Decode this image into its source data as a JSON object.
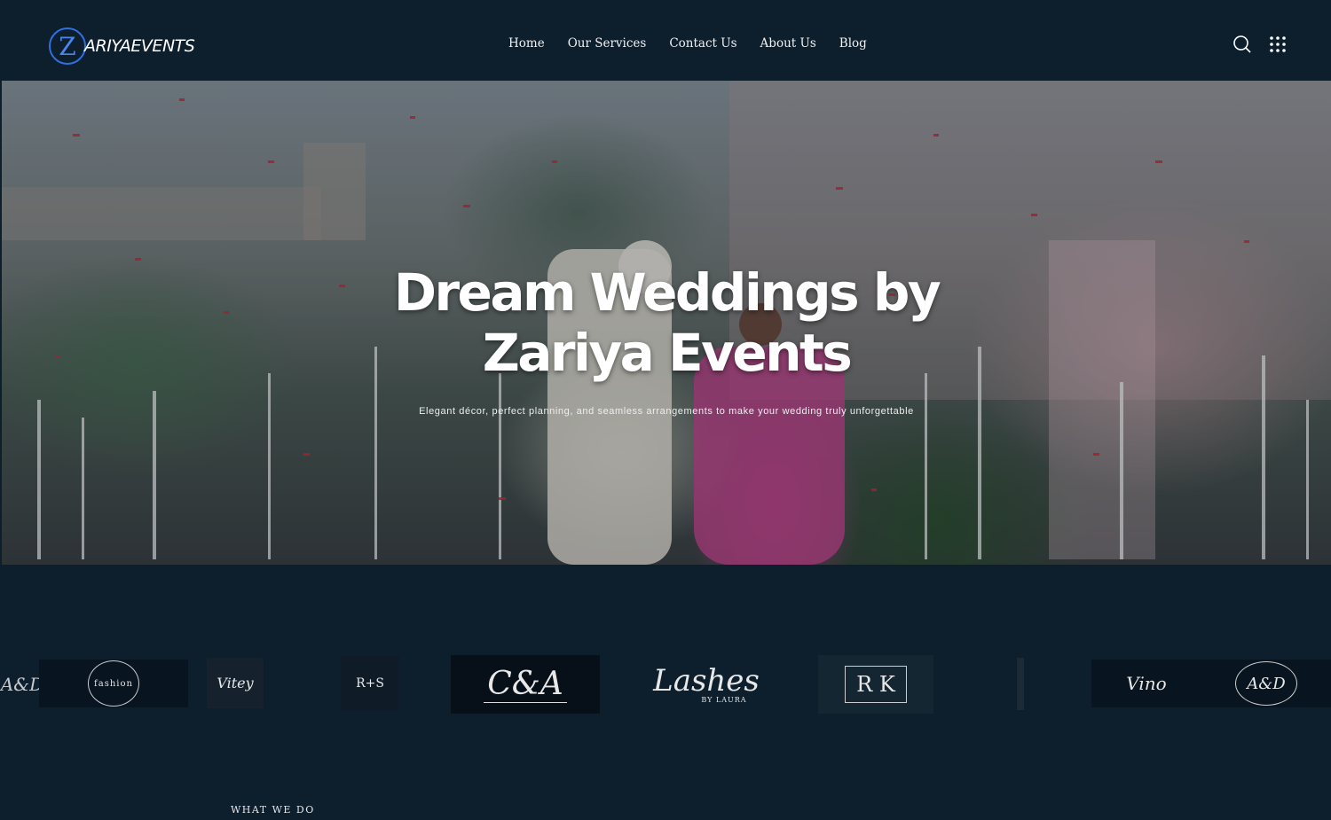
{
  "brand": {
    "logo_letter": "Z",
    "logo_text": "ARIYAEVENTS"
  },
  "nav": [
    {
      "label": "Home"
    },
    {
      "label": "Our Services"
    },
    {
      "label": "Contact Us"
    },
    {
      "label": "About Us"
    },
    {
      "label": "Blog"
    }
  ],
  "icons": {
    "search": "search-icon",
    "menu": "grid-menu-icon"
  },
  "hero": {
    "title_line1": "Dream Weddings by",
    "title_line2": "Zariya Events",
    "subtitle": "Elegant décor, perfect planning, and seamless arrangements to make your wedding truly unforgettable"
  },
  "client_logos": [
    {
      "text": "A&D"
    },
    {
      "text": "fashion"
    },
    {
      "text": "Vitey"
    },
    {
      "text": "R+S"
    },
    {
      "text": "C&A"
    },
    {
      "text": "Lashes",
      "sub": "BY LAURA"
    },
    {
      "text": "R K"
    },
    {
      "text": ""
    },
    {
      "text": "Vino"
    },
    {
      "text": "A&D"
    }
  ],
  "section": {
    "eyebrow": "WHAT WE DO"
  },
  "colors": {
    "background": "#0d1e2d",
    "logo_accent": "#2f6fe0"
  }
}
